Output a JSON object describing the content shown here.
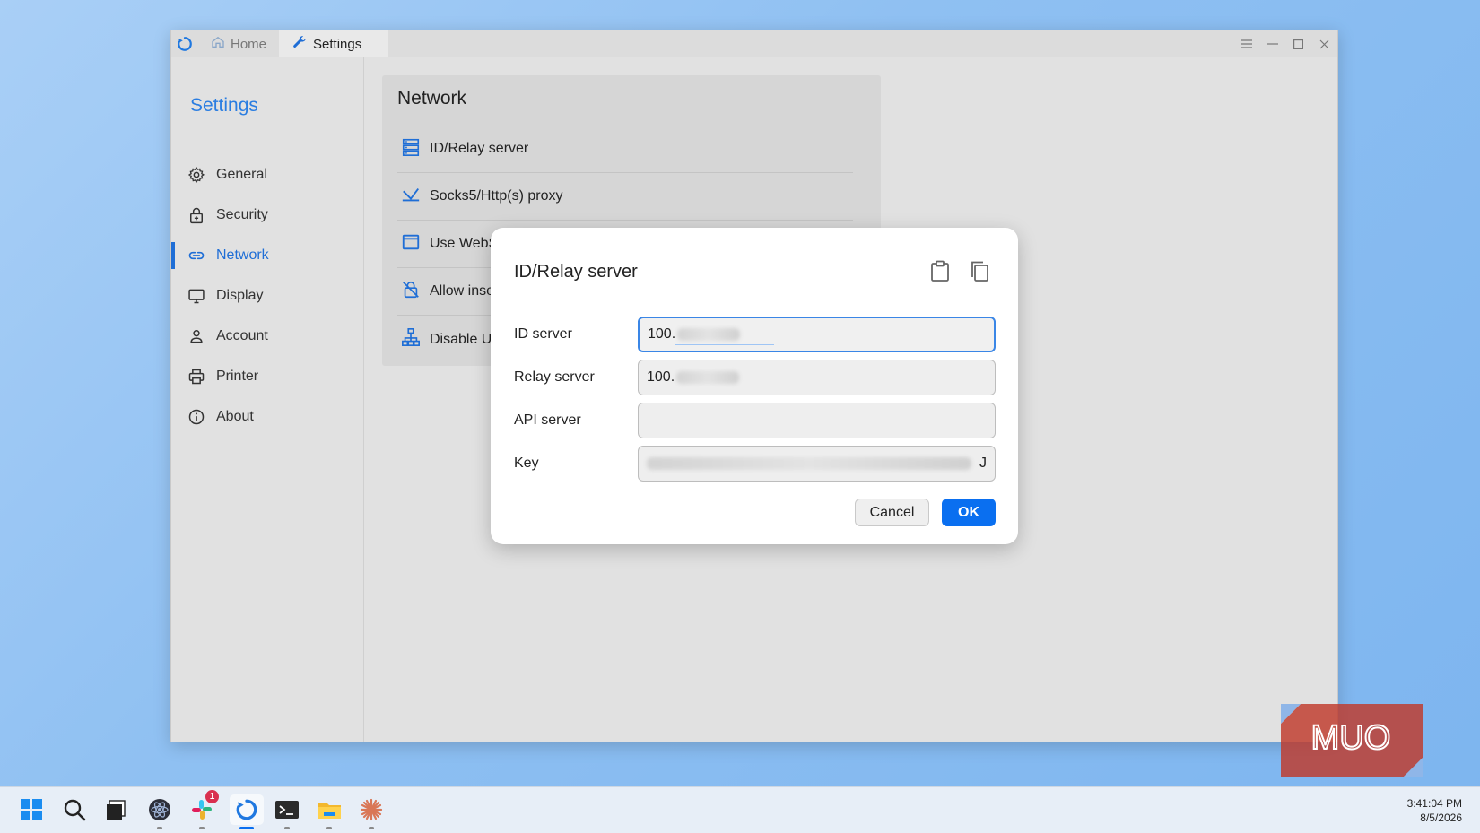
{
  "window": {
    "tabs": [
      {
        "label": "Home",
        "icon": "home-icon"
      },
      {
        "label": "Settings",
        "icon": "wrench-icon"
      }
    ],
    "controls": [
      "menu-icon",
      "minimize-icon",
      "maximize-icon",
      "close-icon"
    ]
  },
  "sidebar": {
    "title": "Settings",
    "items": [
      {
        "label": "General",
        "icon": "gear-icon"
      },
      {
        "label": "Security",
        "icon": "lock-icon"
      },
      {
        "label": "Network",
        "icon": "link-icon",
        "active": true
      },
      {
        "label": "Display",
        "icon": "monitor-icon"
      },
      {
        "label": "Account",
        "icon": "person-icon"
      },
      {
        "label": "Printer",
        "icon": "printer-icon"
      },
      {
        "label": "About",
        "icon": "info-icon"
      }
    ]
  },
  "network_card": {
    "title": "Network",
    "rows": [
      {
        "label": "ID/Relay server",
        "icon": "server-icon"
      },
      {
        "label": "Socks5/Http(s) proxy",
        "icon": "proxy-icon"
      },
      {
        "label": "Use WebS",
        "icon": "window-icon"
      },
      {
        "label": "Allow inse",
        "icon": "lock-off-icon"
      },
      {
        "label": "Disable UI",
        "icon": "network-tree-icon"
      }
    ]
  },
  "dialog": {
    "title": "ID/Relay server",
    "fields": [
      {
        "label": "ID server",
        "value": "100."
      },
      {
        "label": "Relay server",
        "value": "100."
      },
      {
        "label": "API server",
        "value": ""
      },
      {
        "label": "Key",
        "value": "J"
      }
    ],
    "cancel_label": "Cancel",
    "ok_label": "OK"
  },
  "watermark": {
    "text": "MUO"
  },
  "taskbar": {
    "apps": [
      "windows-start-icon",
      "search-icon",
      "task-view-icon",
      "app-icon",
      "slack-icon",
      "rustdesk-icon",
      "terminal-icon",
      "file-explorer-icon",
      "claude-icon"
    ],
    "slack_badge": "1",
    "time": "3:41:04 PM",
    "date": "8/5/2026"
  },
  "colors": {
    "accent": "#1f6ed6",
    "ok_button": "#0a6ff0",
    "watermark": "#c0392b"
  }
}
